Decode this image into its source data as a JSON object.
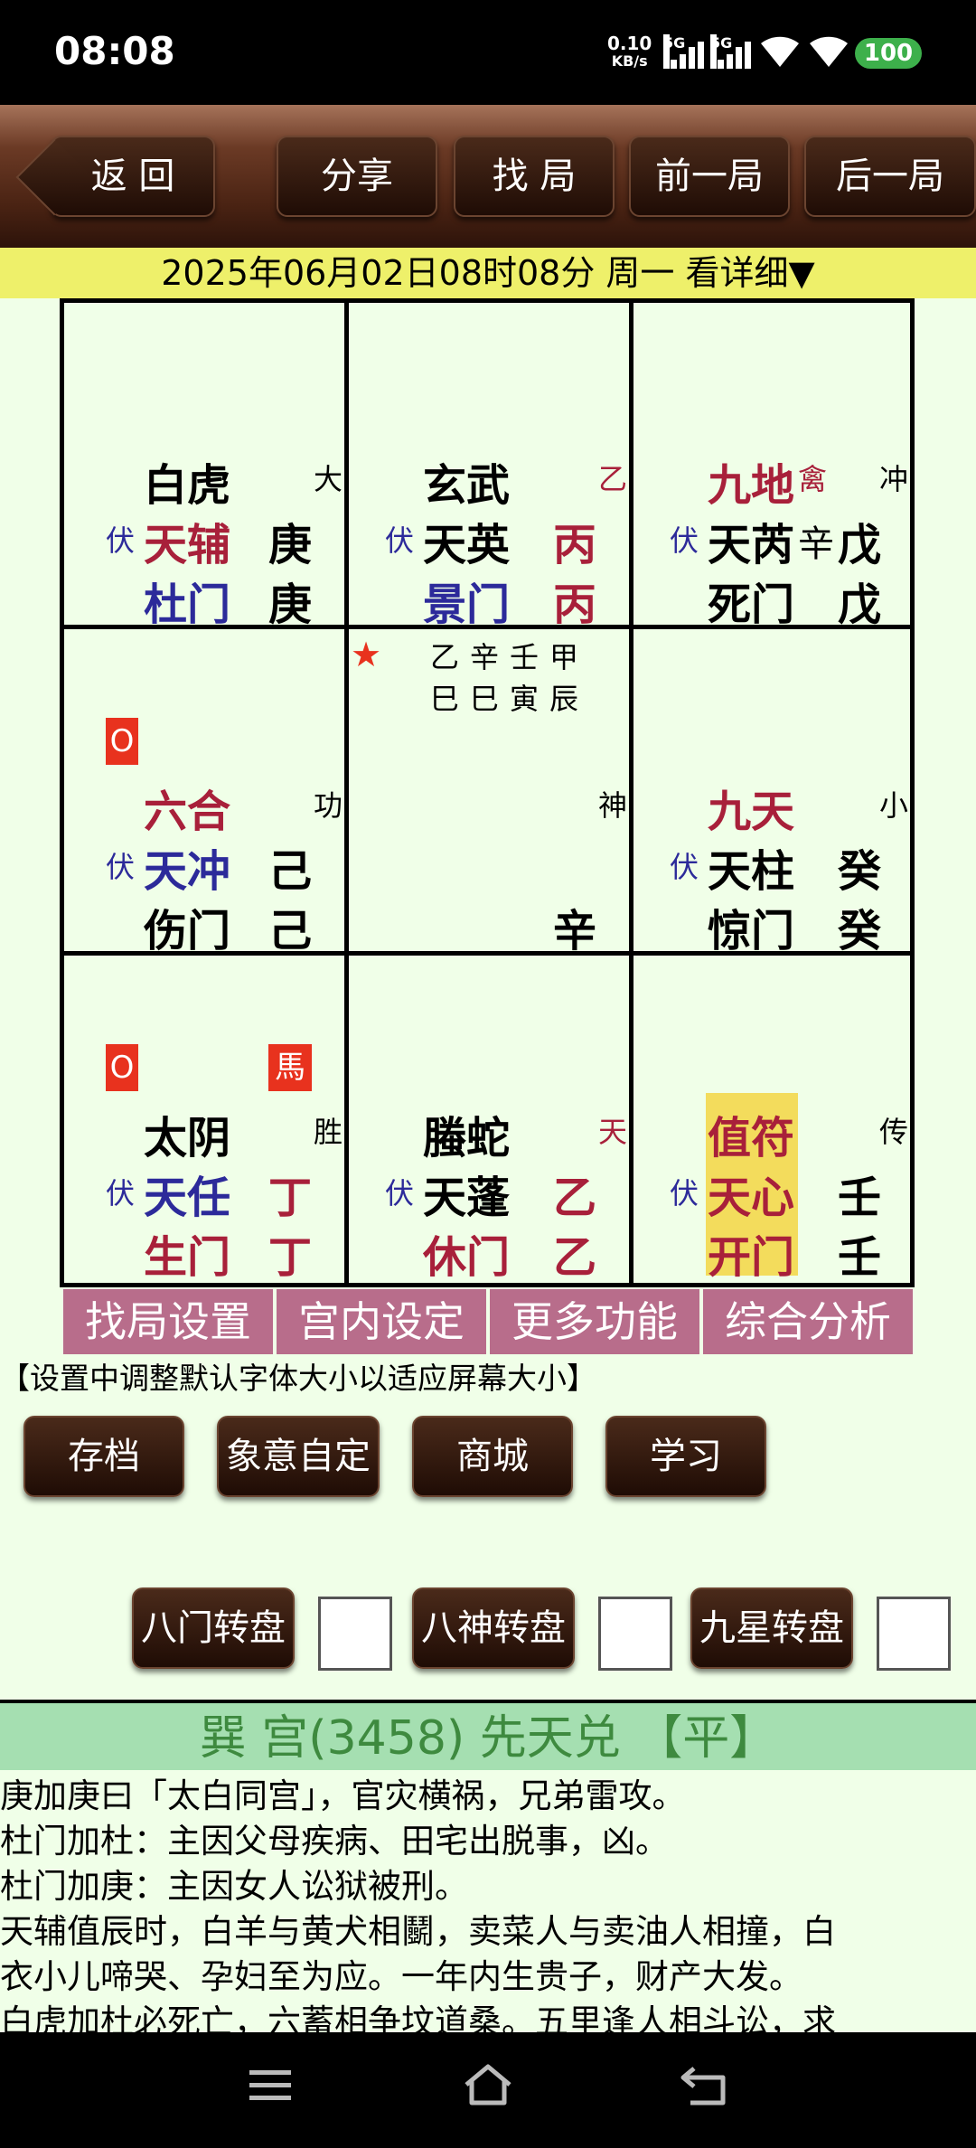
{
  "status_bar": {
    "time": "08:08",
    "net_speed_value": "0.10",
    "net_speed_unit": "KB/s",
    "sim1": "5G",
    "sim2": "5G",
    "battery": "100"
  },
  "toolbar": {
    "back": "返 回",
    "share": "分享",
    "find": "找 局",
    "prev": "前一局",
    "next": "后一局"
  },
  "date_line": "2025年06月02日08时08分 周一 看详细▼",
  "palaces": {
    "p1": {
      "god": "白虎",
      "corner": "大",
      "fu": "伏",
      "star": "天辅",
      "star_stem": "庚",
      "door": "杜门",
      "door_stem": "庚"
    },
    "p2": {
      "god": "玄武",
      "corner": "乙",
      "fu": "伏",
      "star": "天英",
      "star_stem": "丙",
      "door": "景门",
      "door_stem": "丙"
    },
    "p3": {
      "god": "九地",
      "god_extra": "禽",
      "corner": "冲",
      "fu": "伏",
      "star": "天芮",
      "star_extra": "辛",
      "star_stem": "戊",
      "door": "死门",
      "door_stem": "戊"
    },
    "p4": {
      "marker": "O",
      "god": "六合",
      "corner": "功",
      "fu": "伏",
      "star": "天冲",
      "star_stem": "己",
      "door": "伤门",
      "door_stem": "己"
    },
    "p5": {
      "star_symbol": "★",
      "row1": [
        "乙",
        "辛",
        "壬",
        "甲"
      ],
      "row2": [
        "巳",
        "巳",
        "寅",
        "辰"
      ],
      "shen": "神",
      "stem": "辛"
    },
    "p6": {
      "god": "九天",
      "corner": "小",
      "fu": "伏",
      "star": "天柱",
      "star_stem": "癸",
      "door": "惊门",
      "door_stem": "癸"
    },
    "p7": {
      "marker": "O",
      "horse": "馬",
      "god": "太阴",
      "corner": "胜",
      "fu": "伏",
      "star": "天任",
      "star_stem": "丁",
      "door": "生门",
      "door_stem": "丁"
    },
    "p8": {
      "god": "螣蛇",
      "corner": "天",
      "fu": "伏",
      "star": "天蓬",
      "star_stem": "乙",
      "door": "休门",
      "door_stem": "乙"
    },
    "p9": {
      "god": "值符",
      "corner": "传",
      "fu": "伏",
      "star": "天心",
      "star_stem": "壬",
      "door": "开门",
      "door_stem": "壬"
    }
  },
  "tabs": [
    "找局设置",
    "宫内设定",
    "更多功能",
    "综合分析"
  ],
  "notice": "【设置中调整默认字体大小以适应屏幕大小】",
  "buttons": [
    "存档",
    "象意自定",
    "商城",
    "学习"
  ],
  "rotate": [
    "八门转盘",
    "八神转盘",
    "九星转盘"
  ],
  "info_header": "巽 宫(3458) 先天兑  【平】",
  "info_lines": [
    "庚加庚曰「太白同宫」，官灾横祸，兄弟雷攻。",
    "杜门加杜：主因父母疾病、田宅出脱事，凶。",
    "杜门加庚：主因女人讼狱被刑。",
    "天辅值辰时，白羊与黄犬相鬭，卖菜人与卖油人相撞，白",
    "衣小儿啼哭、孕妇至为应。一年内生贵子，财产大发。",
    "白虎加杜必死亡，六蓄相争坟道桑。五里逢人相斗讼，求"
  ]
}
